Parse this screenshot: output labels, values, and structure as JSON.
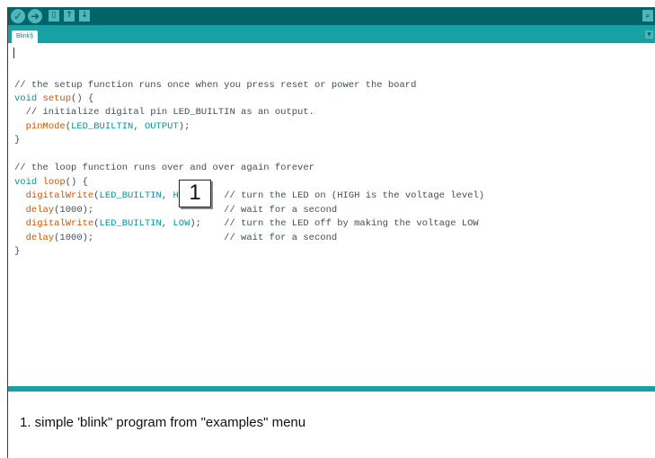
{
  "toolbar": {
    "verify_icon": "check-icon",
    "upload_icon": "arrow-right-icon",
    "new_icon": "new-file-icon",
    "open_icon": "open-arrow-up-icon",
    "save_icon": "save-arrow-down-icon",
    "serial_monitor_icon": "magnifier-icon"
  },
  "tabs": [
    {
      "label": "Blink§"
    }
  ],
  "editor": {
    "lines": [
      [
        {
          "c": "comment",
          "t": "// the setup function runs once when you press reset or power the board"
        }
      ],
      [
        {
          "c": "kw-type",
          "t": "void"
        },
        {
          "c": "plain",
          "t": " "
        },
        {
          "c": "kw-fn",
          "t": "setup"
        },
        {
          "c": "plain",
          "t": "() {"
        }
      ],
      [
        {
          "c": "comment",
          "t": "  // initialize digital pin LED_BUILTIN as an output."
        }
      ],
      [
        {
          "c": "plain",
          "t": "  "
        },
        {
          "c": "kw-fn",
          "t": "pinMode"
        },
        {
          "c": "plain",
          "t": "("
        },
        {
          "c": "kw-const",
          "t": "LED_BUILTIN"
        },
        {
          "c": "plain",
          "t": ", "
        },
        {
          "c": "kw-const",
          "t": "OUTPUT"
        },
        {
          "c": "plain",
          "t": ");"
        }
      ],
      [
        {
          "c": "plain",
          "t": "}"
        }
      ],
      [
        {
          "c": "plain",
          "t": ""
        }
      ],
      [
        {
          "c": "comment",
          "t": "// the loop function runs over and over again forever"
        }
      ],
      [
        {
          "c": "kw-type",
          "t": "void"
        },
        {
          "c": "plain",
          "t": " "
        },
        {
          "c": "kw-fn",
          "t": "loop"
        },
        {
          "c": "plain",
          "t": "() {"
        }
      ],
      [
        {
          "c": "plain",
          "t": "  "
        },
        {
          "c": "kw-fn",
          "t": "digitalWrite"
        },
        {
          "c": "plain",
          "t": "("
        },
        {
          "c": "kw-const",
          "t": "LED_BUILTIN"
        },
        {
          "c": "plain",
          "t": ", "
        },
        {
          "c": "kw-const",
          "t": "HIGH"
        },
        {
          "c": "plain",
          "t": ");   "
        },
        {
          "c": "comment",
          "t": "// turn the LED on (HIGH is the voltage level)"
        }
      ],
      [
        {
          "c": "plain",
          "t": "  "
        },
        {
          "c": "kw-fn",
          "t": "delay"
        },
        {
          "c": "plain",
          "t": "(1000);                       "
        },
        {
          "c": "comment",
          "t": "// wait for a second"
        }
      ],
      [
        {
          "c": "plain",
          "t": "  "
        },
        {
          "c": "kw-fn",
          "t": "digitalWrite"
        },
        {
          "c": "plain",
          "t": "("
        },
        {
          "c": "kw-const",
          "t": "LED_BUILTIN"
        },
        {
          "c": "plain",
          "t": ", "
        },
        {
          "c": "kw-const",
          "t": "LOW"
        },
        {
          "c": "plain",
          "t": ");    "
        },
        {
          "c": "comment",
          "t": "// turn the LED off by making the voltage LOW"
        }
      ],
      [
        {
          "c": "plain",
          "t": "  "
        },
        {
          "c": "kw-fn",
          "t": "delay"
        },
        {
          "c": "plain",
          "t": "(1000);                       "
        },
        {
          "c": "comment",
          "t": "// wait for a second"
        }
      ],
      [
        {
          "c": "plain",
          "t": "}"
        }
      ]
    ]
  },
  "callout": {
    "number": "1"
  },
  "caption": {
    "text": "1. simple 'blink\" program from \"examples\" menu"
  },
  "colors": {
    "toolbar_bg": "#006468",
    "tabbar_bg": "#17a1a5",
    "button_fill": "#4db7bb",
    "keyword_teal": "#00979c",
    "function_orange": "#d35400",
    "code_text": "#434f54"
  }
}
